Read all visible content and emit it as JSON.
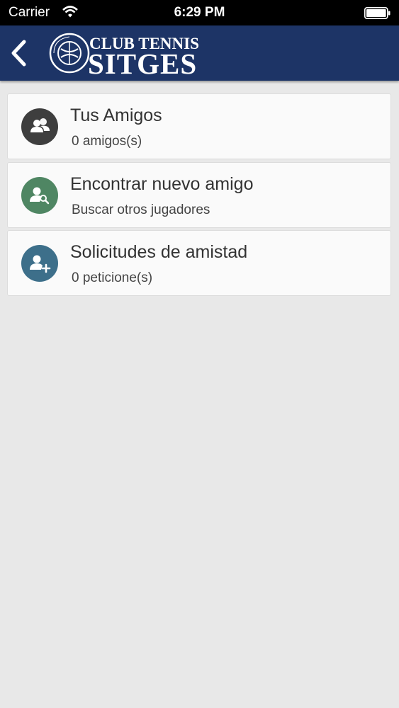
{
  "status_bar": {
    "carrier": "Carrier",
    "time": "6:29 PM"
  },
  "header": {
    "logo_line1": "CLUB TENNIS",
    "logo_line2": "SITGES",
    "logo_seal_text_top": "CLUB TENNIS",
    "logo_seal_text_bottom": "SITGES",
    "background_color": "#1d3466"
  },
  "menu": {
    "items": [
      {
        "title": "Tus Amigos",
        "subtitle": "0 amigos(s)",
        "icon": "friends-icon",
        "color": "#3e3e3e"
      },
      {
        "title": "Encontrar nuevo amigo",
        "subtitle": "Buscar otros jugadores",
        "icon": "search-user-icon",
        "color": "#4f8663"
      },
      {
        "title": "Solicitudes de amistad",
        "subtitle": "0 peticione(s)",
        "icon": "add-user-icon",
        "color": "#3d6f8a"
      }
    ]
  }
}
